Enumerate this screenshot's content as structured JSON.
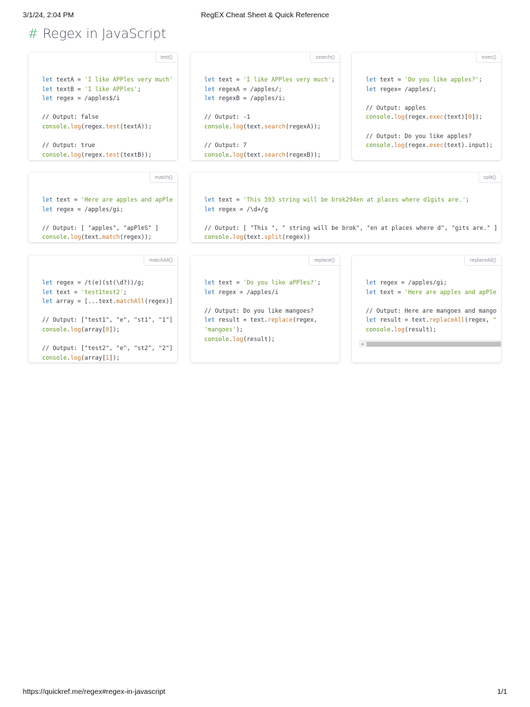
{
  "print_header": {
    "date": "3/1/24, 2:04 PM",
    "title": "RegEX Cheat Sheet & Quick Reference"
  },
  "print_footer": {
    "url": "https://quickref.me/regex#regex-in-javascript",
    "pages": "1/1"
  },
  "heading": {
    "hash": "#",
    "text": "Regex in JavaScript"
  },
  "colors": {
    "keyword": "#2f6fab",
    "string": "#6a9a2a",
    "function": "#c5762d",
    "hash": "#3fa66b"
  },
  "cards": {
    "test": {
      "tag": "test()",
      "lines": [
        [
          [
            "let",
            "kw"
          ],
          [
            " textA = ",
            ""
          ],
          [
            "'I like APPles very much'",
            "str"
          ]
        ],
        [
          [
            "let",
            "kw"
          ],
          [
            " textB = ",
            ""
          ],
          [
            "'I like APPles'",
            "str"
          ],
          [
            ";",
            ""
          ]
        ],
        [
          [
            "let",
            "kw"
          ],
          [
            " regex = /apples$/i",
            ""
          ]
        ],
        [],
        [
          [
            "// Output: false",
            ""
          ]
        ],
        [
          [
            "console",
            "obj"
          ],
          [
            ".",
            ""
          ],
          [
            "log",
            "fn"
          ],
          [
            "(regex.",
            ""
          ],
          [
            "test",
            "fn"
          ],
          [
            "(textA));",
            ""
          ]
        ],
        [],
        [
          [
            "// Output: true",
            ""
          ]
        ],
        [
          [
            "console",
            "obj"
          ],
          [
            ".",
            ""
          ],
          [
            "log",
            "fn"
          ],
          [
            "(regex.",
            ""
          ],
          [
            "test",
            "fn"
          ],
          [
            "(textB));",
            ""
          ]
        ]
      ]
    },
    "search": {
      "tag": "search()",
      "lines": [
        [
          [
            "let",
            "kw"
          ],
          [
            " text = ",
            ""
          ],
          [
            "'I like APPles very much'",
            "str"
          ],
          [
            ";",
            ""
          ]
        ],
        [
          [
            "let",
            "kw"
          ],
          [
            " regexA = /apples/;",
            ""
          ]
        ],
        [
          [
            "let",
            "kw"
          ],
          [
            " regexB = /apples/i;",
            ""
          ]
        ],
        [],
        [
          [
            "// Output: -1",
            ""
          ]
        ],
        [
          [
            "console",
            "obj"
          ],
          [
            ".",
            ""
          ],
          [
            "log",
            "fn"
          ],
          [
            "(text.",
            ""
          ],
          [
            "search",
            "fn"
          ],
          [
            "(regexA));",
            ""
          ]
        ],
        [],
        [
          [
            "// Output: 7",
            ""
          ]
        ],
        [
          [
            "console",
            "obj"
          ],
          [
            ".",
            ""
          ],
          [
            "log",
            "fn"
          ],
          [
            "(text.",
            ""
          ],
          [
            "search",
            "fn"
          ],
          [
            "(regexB));",
            ""
          ]
        ]
      ]
    },
    "exec": {
      "tag": "exec()",
      "lines": [
        [
          [
            "let",
            "kw"
          ],
          [
            " text = ",
            ""
          ],
          [
            "'Do you like apples?'",
            "str"
          ],
          [
            ";",
            ""
          ]
        ],
        [
          [
            "let",
            "kw"
          ],
          [
            " regex= /apples/;",
            ""
          ]
        ],
        [],
        [
          [
            "// Output: apples",
            ""
          ]
        ],
        [
          [
            "console",
            "obj"
          ],
          [
            ".",
            ""
          ],
          [
            "log",
            "fn"
          ],
          [
            "(regex.",
            ""
          ],
          [
            "exec",
            "fn"
          ],
          [
            "(text)[",
            ""
          ],
          [
            "0",
            "fn"
          ],
          [
            "]);",
            ""
          ]
        ],
        [],
        [
          [
            "// Output: Do you like apples?",
            ""
          ]
        ],
        [
          [
            "console",
            "obj"
          ],
          [
            ".",
            ""
          ],
          [
            "log",
            "fn"
          ],
          [
            "(regex.",
            ""
          ],
          [
            "exec",
            "fn"
          ],
          [
            "(text).input);",
            ""
          ]
        ]
      ]
    },
    "match": {
      "tag": "match()",
      "lines": [
        [
          [
            "let",
            "kw"
          ],
          [
            " text = ",
            ""
          ],
          [
            "'Here are apples and apPle",
            "str"
          ]
        ],
        [
          [
            "let",
            "kw"
          ],
          [
            " regex = /apples/gi;",
            ""
          ]
        ],
        [],
        [
          [
            "// Output: [ \"apples\", \"apPleS\" ]",
            ""
          ]
        ],
        [
          [
            "console",
            "obj"
          ],
          [
            ".",
            ""
          ],
          [
            "log",
            "fn"
          ],
          [
            "(text.",
            ""
          ],
          [
            "match",
            "fn"
          ],
          [
            "(regex));",
            ""
          ]
        ]
      ]
    },
    "split": {
      "tag": "split()",
      "lines": [
        [
          [
            "let",
            "kw"
          ],
          [
            " text = ",
            ""
          ],
          [
            "'This 593 string will be brok294en at places where d1gits are.'",
            "str"
          ],
          [
            ";",
            ""
          ]
        ],
        [
          [
            "let",
            "kw"
          ],
          [
            " regex = /\\d+/g",
            ""
          ]
        ],
        [],
        [
          [
            "// Output: [ \"This \", \" string will be brok\", \"en at places where d\", \"gits are.\" ]",
            ""
          ]
        ],
        [
          [
            "console",
            "obj"
          ],
          [
            ".",
            ""
          ],
          [
            "log",
            "fn"
          ],
          [
            "(text.",
            ""
          ],
          [
            "split",
            "fn"
          ],
          [
            "(regex))",
            ""
          ]
        ]
      ]
    },
    "matchall": {
      "tag": "matchAll()",
      "lines": [
        [
          [
            "let",
            "kw"
          ],
          [
            " regex = /t(e)(st(\\d?))/g;",
            ""
          ]
        ],
        [
          [
            "let",
            "kw"
          ],
          [
            " text = ",
            ""
          ],
          [
            "'test1test2'",
            "str"
          ],
          [
            ";",
            ""
          ]
        ],
        [
          [
            "let",
            "kw"
          ],
          [
            " array = [...text.",
            ""
          ],
          [
            "matchAll",
            "fn"
          ],
          [
            "(regex)]",
            ""
          ]
        ],
        [],
        [
          [
            "// Output: [\"test1\", \"e\", \"st1\", \"1\"]",
            ""
          ]
        ],
        [
          [
            "console",
            "obj"
          ],
          [
            ".",
            ""
          ],
          [
            "log",
            "fn"
          ],
          [
            "(array[",
            ""
          ],
          [
            "0",
            "fn"
          ],
          [
            "]);",
            ""
          ]
        ],
        [],
        [
          [
            "// Output: [\"test2\", \"e\", \"st2\", \"2\"]",
            ""
          ]
        ],
        [
          [
            "console",
            "obj"
          ],
          [
            ".",
            ""
          ],
          [
            "log",
            "fn"
          ],
          [
            "(array[",
            ""
          ],
          [
            "1",
            "fn"
          ],
          [
            "]);",
            ""
          ]
        ]
      ]
    },
    "replace": {
      "tag": "replace()",
      "lines": [
        [
          [
            "let",
            "kw"
          ],
          [
            " text = ",
            ""
          ],
          [
            "'Do you like aPPles?'",
            "str"
          ],
          [
            ";",
            ""
          ]
        ],
        [
          [
            "let",
            "kw"
          ],
          [
            " regex = /apples/i",
            ""
          ]
        ],
        [],
        [
          [
            "// Output: Do you like mangoes?",
            ""
          ]
        ],
        [
          [
            "let",
            "kw"
          ],
          [
            " result = text.",
            ""
          ],
          [
            "replace",
            "fn"
          ],
          [
            "(regex,",
            ""
          ]
        ],
        [
          [
            "'mangoes'",
            "str"
          ],
          [
            ");",
            ""
          ]
        ],
        [
          [
            "console",
            "obj"
          ],
          [
            ".",
            ""
          ],
          [
            "log",
            "fn"
          ],
          [
            "(result);",
            ""
          ]
        ]
      ]
    },
    "replaceall": {
      "tag": "replaceAll()",
      "lines": [
        [
          [
            "let",
            "kw"
          ],
          [
            " regex = /apples/gi;",
            ""
          ]
        ],
        [
          [
            "let",
            "kw"
          ],
          [
            " text = ",
            ""
          ],
          [
            "'Here are apples and apPle",
            "str"
          ]
        ],
        [],
        [
          [
            "// Output: Here are mangoes and mango",
            ""
          ]
        ],
        [
          [
            "let",
            "kw"
          ],
          [
            " result = text.",
            ""
          ],
          [
            "replaceAll",
            "fn"
          ],
          [
            "(regex, ",
            ""
          ],
          [
            "\"",
            "str"
          ]
        ],
        [
          [
            "console",
            "obj"
          ],
          [
            ".",
            ""
          ],
          [
            "log",
            "fn"
          ],
          [
            "(result);",
            ""
          ]
        ]
      ],
      "scroll_arrow": "◂"
    }
  }
}
